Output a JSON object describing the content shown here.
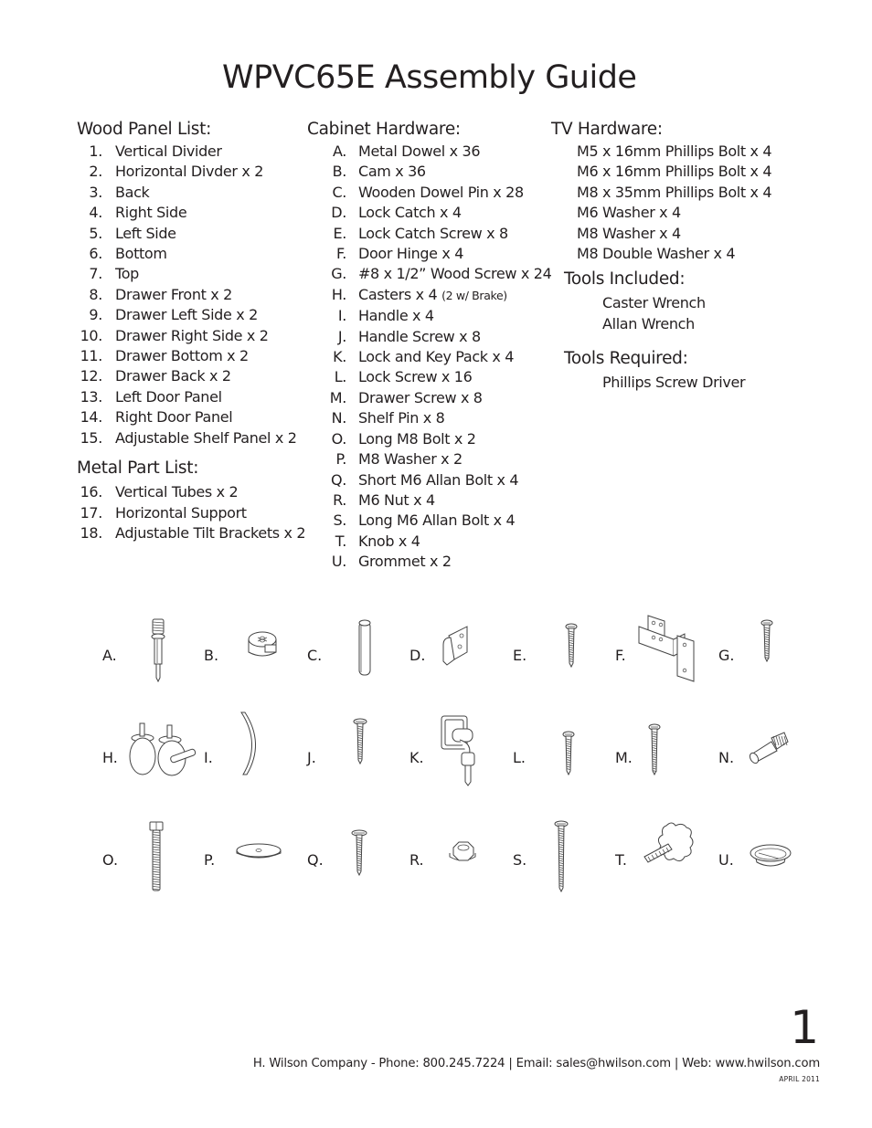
{
  "title": "WPVC65E Assembly Guide",
  "wood_panel_list": {
    "heading": "Wood Panel List:",
    "items": [
      {
        "num": "1.",
        "label": "Vertical Divider"
      },
      {
        "num": "2.",
        "label": "Horizontal Divder x 2"
      },
      {
        "num": "3.",
        "label": "Back"
      },
      {
        "num": "4.",
        "label": "Right Side"
      },
      {
        "num": "5.",
        "label": "Left Side"
      },
      {
        "num": "6.",
        "label": "Bottom"
      },
      {
        "num": "7.",
        "label": "Top"
      },
      {
        "num": "8.",
        "label": "Drawer Front x 2"
      },
      {
        "num": "9.",
        "label": "Drawer Left Side x 2"
      },
      {
        "num": "10.",
        "label": "Drawer Right Side x 2"
      },
      {
        "num": "11.",
        "label": "Drawer Bottom x 2"
      },
      {
        "num": "12.",
        "label": "Drawer Back x 2"
      },
      {
        "num": "13.",
        "label": "Left Door Panel"
      },
      {
        "num": "14.",
        "label": "Right Door Panel"
      },
      {
        "num": "15.",
        "label": "Adjustable Shelf Panel x 2"
      }
    ]
  },
  "metal_part_list": {
    "heading": "Metal Part List:",
    "items": [
      {
        "num": "16.",
        "label": "Vertical Tubes x 2"
      },
      {
        "num": "17.",
        "label": "Horizontal Support"
      },
      {
        "num": "18.",
        "label": "Adjustable Tilt Brackets x 2"
      }
    ]
  },
  "cabinet_hardware": {
    "heading": "Cabinet Hardware:",
    "items": [
      {
        "num": "A.",
        "label": "Metal Dowel x 36",
        "note": ""
      },
      {
        "num": "B.",
        "label": "Cam x 36",
        "note": ""
      },
      {
        "num": "C.",
        "label": "Wooden Dowel Pin x 28",
        "note": ""
      },
      {
        "num": "D.",
        "label": "Lock Catch x 4",
        "note": ""
      },
      {
        "num": "E.",
        "label": "Lock Catch Screw x 8",
        "note": ""
      },
      {
        "num": "F.",
        "label": "Door Hinge x 4",
        "note": ""
      },
      {
        "num": "G.",
        "label": "#8 x 1/2” Wood Screw x 24",
        "note": ""
      },
      {
        "num": "H.",
        "label": "Casters x 4 ",
        "note": "(2 w/ Brake)"
      },
      {
        "num": "I.",
        "label": "Handle x 4",
        "note": ""
      },
      {
        "num": "J.",
        "label": "Handle Screw x 8",
        "note": ""
      },
      {
        "num": "K.",
        "label": "Lock and Key Pack x 4",
        "note": ""
      },
      {
        "num": "L.",
        "label": "Lock Screw x 16",
        "note": ""
      },
      {
        "num": "M.",
        "label": "Drawer Screw x 8",
        "note": ""
      },
      {
        "num": "N.",
        "label": "Shelf Pin x 8",
        "note": ""
      },
      {
        "num": "O.",
        "label": "Long M8 Bolt x 2",
        "note": ""
      },
      {
        "num": "P.",
        "label": "M8 Washer x 2",
        "note": ""
      },
      {
        "num": "Q.",
        "label": "Short M6 Allan Bolt x 4",
        "note": ""
      },
      {
        "num": "R.",
        "label": "M6 Nut x 4",
        "note": ""
      },
      {
        "num": "S.",
        "label": "Long M6 Allan Bolt x 4",
        "note": ""
      },
      {
        "num": "T.",
        "label": "Knob x 4",
        "note": ""
      },
      {
        "num": "U.",
        "label": "Grommet x 2",
        "note": ""
      }
    ]
  },
  "tv_hardware": {
    "heading": "TV Hardware:",
    "items": [
      "M5 x 16mm Phillips Bolt x 4",
      "M6 x 16mm Phillips Bolt x 4",
      "M8 x 35mm Phillips Bolt x 4",
      "M6 Washer x 4",
      "M8 Washer x 4",
      "M8 Double Washer x 4"
    ]
  },
  "tools_included": {
    "heading": "Tools Included:",
    "items": [
      "Caster Wrench",
      "Allan Wrench"
    ]
  },
  "tools_required": {
    "heading": "Tools Required:",
    "items": [
      "Phillips Screw Driver"
    ]
  },
  "parts_illustrations": [
    {
      "label": "A.",
      "icon": "metal-dowel-icon"
    },
    {
      "label": "B.",
      "icon": "cam-icon"
    },
    {
      "label": "C.",
      "icon": "wooden-dowel-pin-icon"
    },
    {
      "label": "D.",
      "icon": "lock-catch-icon"
    },
    {
      "label": "E.",
      "icon": "lock-catch-screw-icon"
    },
    {
      "label": "F.",
      "icon": "door-hinge-icon"
    },
    {
      "label": "G.",
      "icon": "wood-screw-icon"
    },
    {
      "label": "H.",
      "icon": "casters-icon"
    },
    {
      "label": "I.",
      "icon": "handle-icon"
    },
    {
      "label": "J.",
      "icon": "handle-screw-icon"
    },
    {
      "label": "K.",
      "icon": "lock-and-key-icon"
    },
    {
      "label": "L.",
      "icon": "lock-screw-icon"
    },
    {
      "label": "M.",
      "icon": "drawer-screw-icon"
    },
    {
      "label": "N.",
      "icon": "shelf-pin-icon"
    },
    {
      "label": "O.",
      "icon": "long-m8-bolt-icon"
    },
    {
      "label": "P.",
      "icon": "m8-washer-icon"
    },
    {
      "label": "Q.",
      "icon": "short-m6-allan-bolt-icon"
    },
    {
      "label": "R.",
      "icon": "m6-nut-icon"
    },
    {
      "label": "S.",
      "icon": "long-m6-allan-bolt-icon"
    },
    {
      "label": "T.",
      "icon": "knob-icon"
    },
    {
      "label": "U.",
      "icon": "grommet-icon"
    }
  ],
  "page_number": "1",
  "footer": {
    "contact": "H. Wilson Company - Phone: 800.245.7224 | Email:  sales@hwilson.com | Web:  www.hwilson.com",
    "date": "APRIL 2011"
  }
}
